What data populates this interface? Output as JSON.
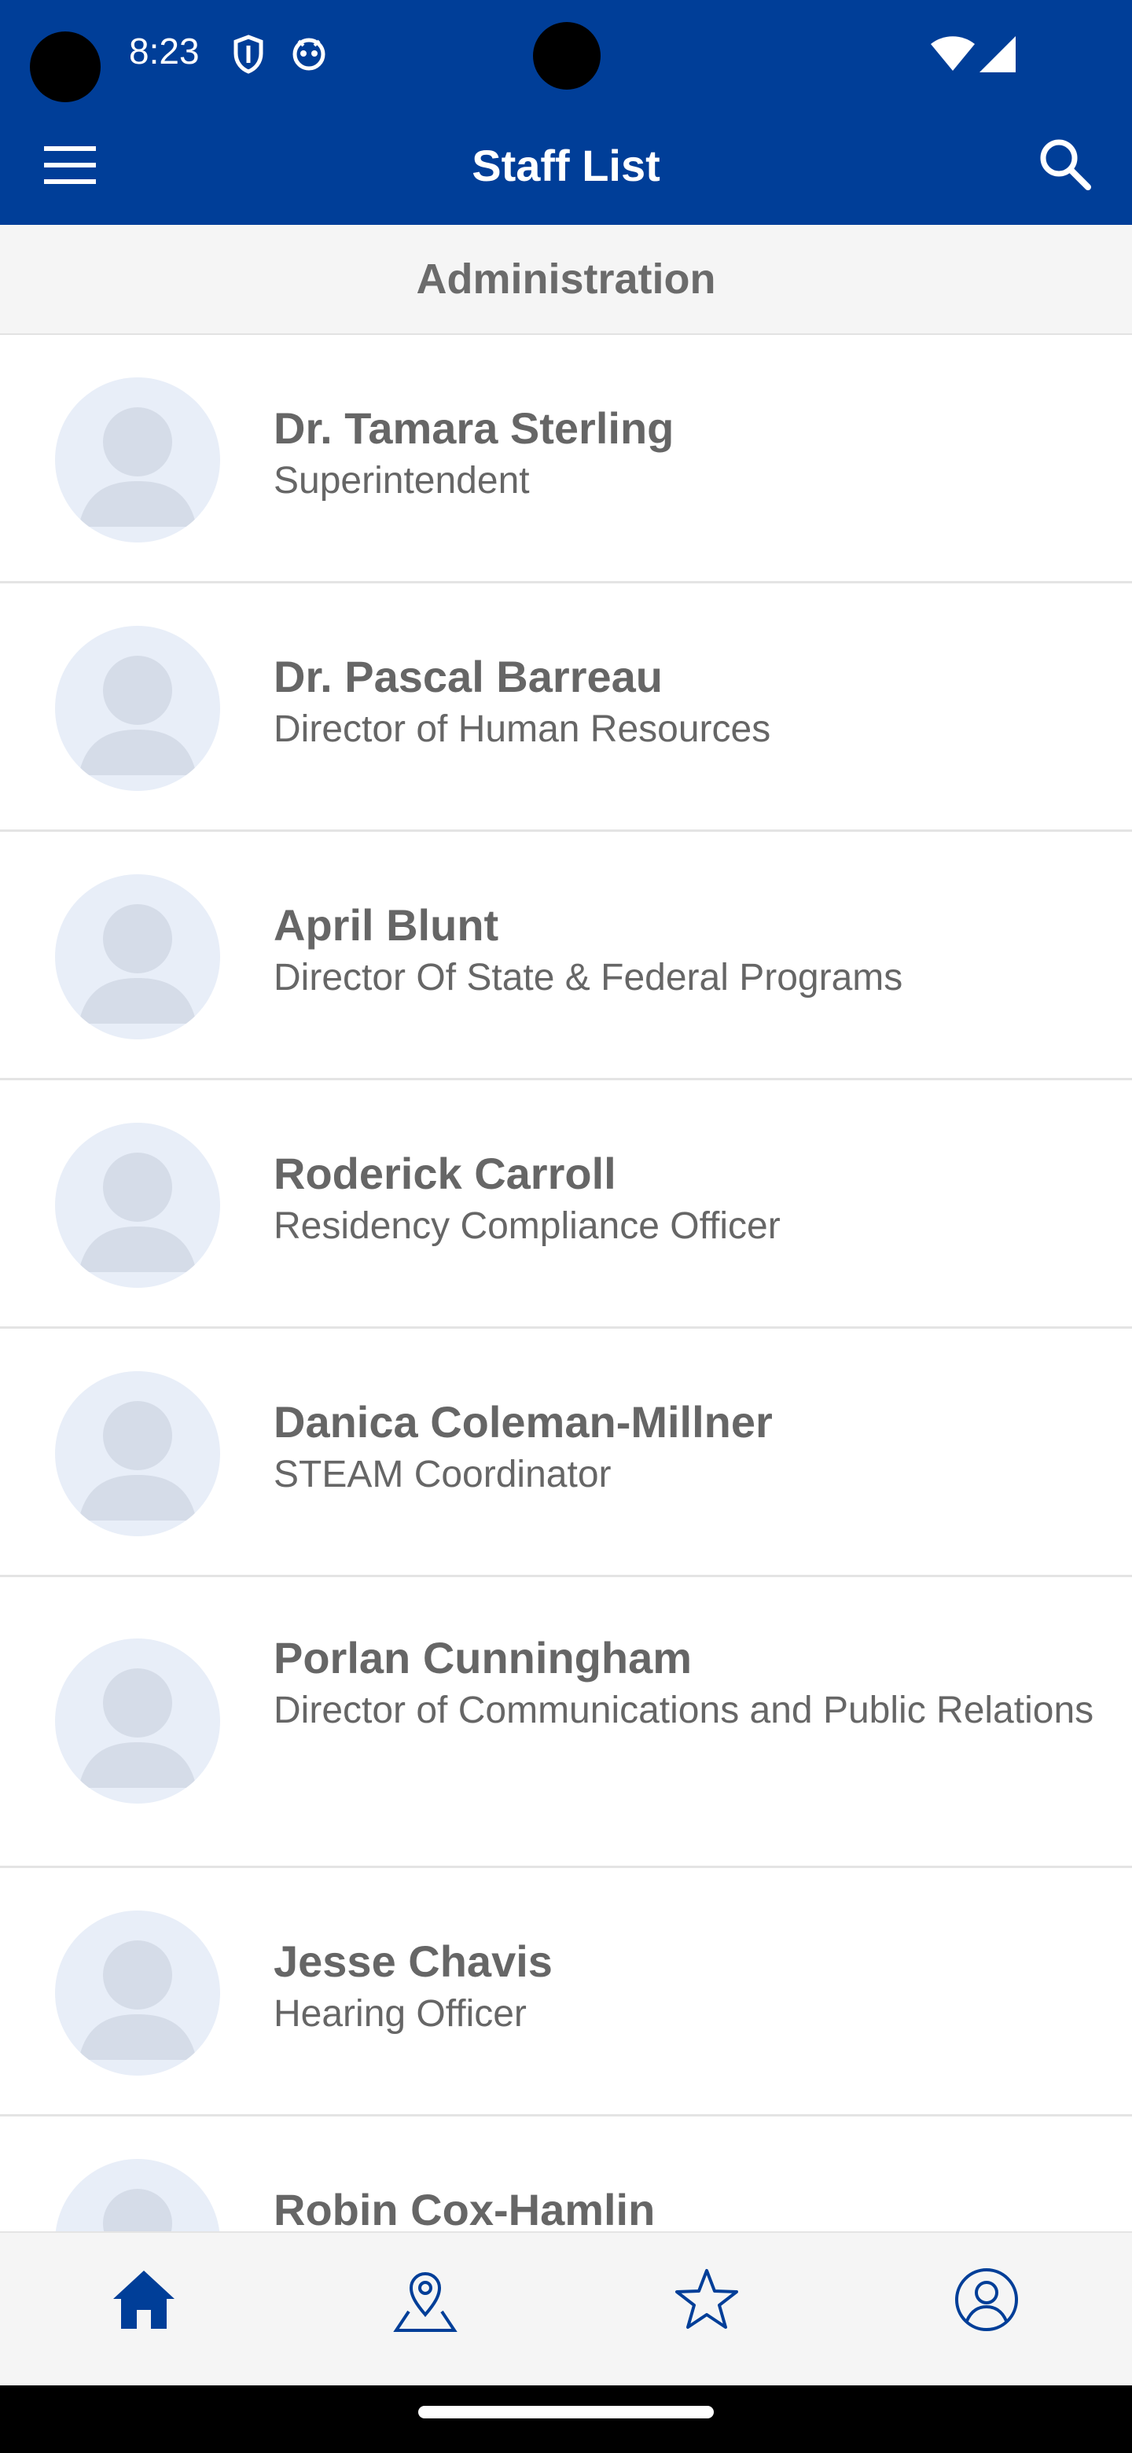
{
  "status_bar": {
    "time": "8:23"
  },
  "app_bar": {
    "title": "Staff List"
  },
  "section": {
    "title": "Administration"
  },
  "staff": [
    {
      "name": "Dr. Tamara Sterling",
      "title": "Superintendent"
    },
    {
      "name": "Dr. Pascal Barreau",
      "title": "Director of Human Resources"
    },
    {
      "name": "April Blunt",
      "title": "Director Of State & Federal Programs"
    },
    {
      "name": "Roderick Carroll",
      "title": "Residency Compliance Officer"
    },
    {
      "name": "Danica Coleman-Millner",
      "title": "STEAM Coordinator"
    },
    {
      "name": "Porlan Cunningham",
      "title": "Director of Communications and Public Relations"
    },
    {
      "name": "Jesse Chavis",
      "title": "Hearing Officer"
    },
    {
      "name": "Robin Cox-Hamlin",
      "title": ""
    }
  ],
  "bottom_nav": [
    {
      "icon": "home-icon",
      "active": true
    },
    {
      "icon": "map-pin-icon",
      "active": false
    },
    {
      "icon": "star-icon",
      "active": false
    },
    {
      "icon": "profile-icon",
      "active": false
    }
  ],
  "colors": {
    "brand": "#003e98",
    "text_gray": "#666666",
    "avatar_bg": "#e8eef8",
    "avatar_fg": "#d5dce8"
  }
}
